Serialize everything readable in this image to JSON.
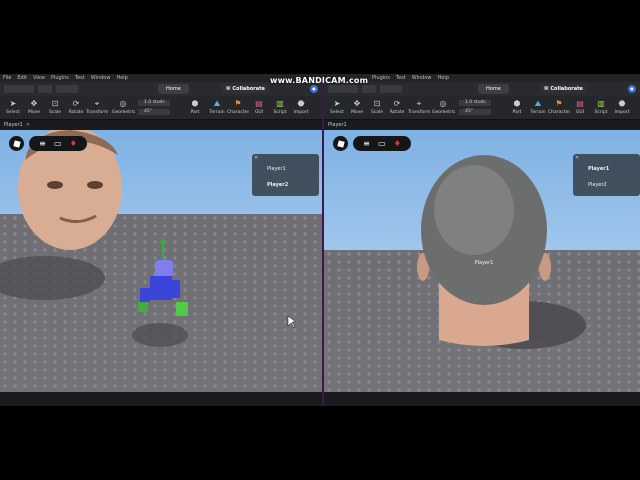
{
  "watermark": "www.BANDICAM.com",
  "menu": [
    "File",
    "Edit",
    "View",
    "Plugins",
    "Test",
    "Window",
    "Help"
  ],
  "tabs": {
    "home": "Home",
    "collaborate": "Collaborate"
  },
  "tools": [
    {
      "label": "Select",
      "icon": "cursor-icon"
    },
    {
      "label": "Move",
      "icon": "move-icon"
    },
    {
      "label": "Scale",
      "icon": "scale-icon"
    },
    {
      "label": "Rotate",
      "icon": "rotate-icon"
    },
    {
      "label": "Transform",
      "icon": "transform-icon"
    },
    {
      "label": "Geometric",
      "icon": "geometric-icon"
    },
    {
      "label": "Part",
      "icon": "part-icon"
    },
    {
      "label": "Terrain",
      "icon": "terrain-icon"
    },
    {
      "label": "Character",
      "icon": "character-icon"
    },
    {
      "label": "GUI",
      "icon": "gui-icon"
    },
    {
      "label": "Script",
      "icon": "script-icon"
    },
    {
      "label": "Import",
      "icon": "import-icon"
    }
  ],
  "snap": {
    "move": "1.0 studs",
    "rotate": "45°"
  },
  "left": {
    "doc": "Player1",
    "players": [
      "Player1",
      "Player2"
    ]
  },
  "right": {
    "doc": "Player1",
    "players": [
      "Player1",
      "Player2"
    ],
    "nameplate": "Player1"
  },
  "colors": {
    "menubar": "#232427",
    "toolbar": "#26272a",
    "sky": "#8dbbe8",
    "baseplate": "#707076",
    "accent": "#3a6fd6",
    "divider": "#3a1a4a"
  }
}
